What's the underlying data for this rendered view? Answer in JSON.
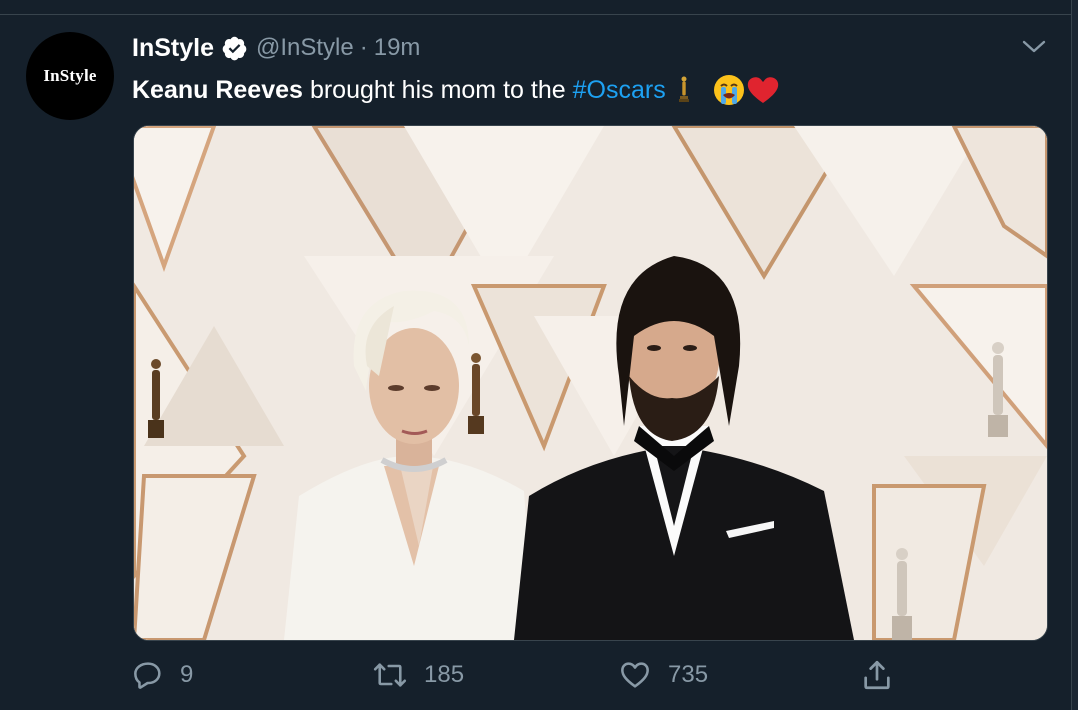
{
  "tweet": {
    "avatar_text": "InStyle",
    "name": "InStyle",
    "handle": "@InStyle",
    "separator": "·",
    "time": "19m",
    "text_bold": "Keanu Reeves",
    "text_normal": "brought his mom to the",
    "hashtag": "#Oscars",
    "emojis": [
      "oscar-statuette-icon",
      "crying-face-icon",
      "red-heart-icon"
    ]
  },
  "media": {
    "alt": "Keanu Reeves with his mother at the Oscars"
  },
  "actions": {
    "reply_count": "9",
    "retweet_count": "185",
    "like_count": "735"
  },
  "colors": {
    "background": "#15202b",
    "secondary_text": "#8899a6",
    "accent": "#1da1f2",
    "verified": "#ffffff"
  }
}
